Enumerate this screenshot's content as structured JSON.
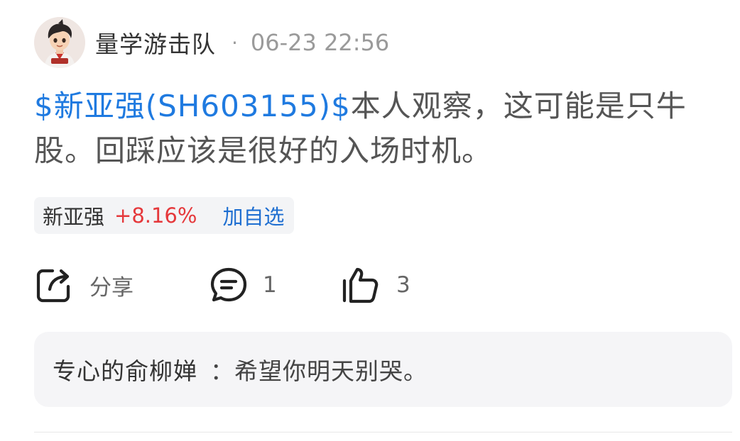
{
  "post": {
    "author": "量学游击队",
    "separator": "·",
    "timestamp": "06-23 22:56",
    "stock_tag": "$新亚强(SH603155)$",
    "body_text": "本人观察，这可能是只牛股。回踩应该是很好的入场时机。"
  },
  "stock_chip": {
    "name": "新亚强",
    "change": "+8.16%",
    "add_label": "加自选"
  },
  "actions": {
    "share_label": "分享",
    "comment_count": "1",
    "like_count": "3"
  },
  "comment_preview": {
    "user": "专心的俞柳婵",
    "text": "：希望你明天别哭。"
  },
  "colors": {
    "link_blue": "#1f7ae0",
    "rise_red": "#e5383b",
    "muted_gray": "#9a9a9a"
  },
  "icons": {
    "share": "share-icon",
    "comment": "comment-icon",
    "like": "thumbs-up-icon"
  }
}
